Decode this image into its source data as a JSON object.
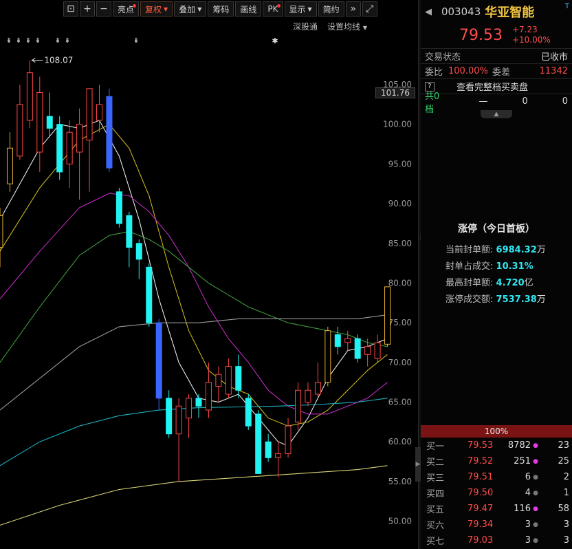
{
  "toolbar": {
    "buttons": [
      "亮点",
      "复权",
      "叠加",
      "筹码",
      "画线",
      "PK",
      "显示",
      "简约"
    ]
  },
  "subbar": {
    "shengu": "深股通",
    "ma_setting": "设置均线"
  },
  "chart": {
    "current_price_tag": "101.76",
    "high_label": "108.07",
    "y_ticks": [
      "105.00",
      "100.00",
      "95.00",
      "90.00",
      "85.00",
      "80.00",
      "75.00",
      "70.00",
      "65.00",
      "60.00",
      "55.00",
      "50.00"
    ]
  },
  "chart_data": {
    "type": "candlestick",
    "y_axis_range": [
      46.5,
      111.5
    ],
    "y_ticks": [
      105,
      100,
      95,
      90,
      85,
      80,
      75,
      70,
      65,
      60,
      55,
      50
    ],
    "annotated_high": 108.07,
    "candles": [
      {
        "o": 84.5,
        "c": 88.5,
        "h": 89.5,
        "l": 82.0,
        "up": true
      },
      {
        "o": 92.5,
        "c": 97.0,
        "h": 99.0,
        "l": 91.5,
        "up": true
      },
      {
        "o": 96.0,
        "c": 102.5,
        "h": 105.0,
        "l": 95.5,
        "up": true
      },
      {
        "o": 100.5,
        "c": 106.5,
        "h": 108.07,
        "l": 99.5,
        "up": true
      },
      {
        "o": 96.5,
        "c": 104.0,
        "h": 106.0,
        "l": 94.0,
        "up": true
      },
      {
        "o": 101.0,
        "c": 99.5,
        "h": 104.0,
        "l": 98.5,
        "up": false
      },
      {
        "o": 100.0,
        "c": 94.0,
        "h": 101.0,
        "l": 93.0,
        "up": false
      },
      {
        "o": 95.0,
        "c": 99.0,
        "h": 100.5,
        "l": 92.0,
        "up": true
      },
      {
        "o": 96.5,
        "c": 100.0,
        "h": 102.0,
        "l": 90.5,
        "up": true
      },
      {
        "o": 98.0,
        "c": 104.5,
        "h": 104.5,
        "l": 91.5,
        "up": true
      },
      {
        "o": 100.5,
        "c": 102.5,
        "h": 105.0,
        "l": 99.0,
        "up": true
      },
      {
        "o": 103.5,
        "c": 94.5,
        "h": 104.5,
        "l": 94.0,
        "up": false
      },
      {
        "o": 91.5,
        "c": 87.5,
        "h": 92.0,
        "l": 87.0,
        "up": false
      },
      {
        "o": 88.5,
        "c": 84.5,
        "h": 89.0,
        "l": 82.0,
        "up": false
      },
      {
        "o": 85.0,
        "c": 83.0,
        "h": 85.5,
        "l": 80.5,
        "up": false
      },
      {
        "o": 82.0,
        "c": 75.0,
        "h": 82.5,
        "l": 74.5,
        "up": false
      },
      {
        "o": 75.0,
        "c": 65.5,
        "h": 75.5,
        "l": 64.0,
        "up": false
      },
      {
        "o": 65.5,
        "c": 61.0,
        "h": 66.5,
        "l": 60.5,
        "up": false
      },
      {
        "o": 61.0,
        "c": 64.5,
        "h": 65.5,
        "l": 55.0,
        "up": true
      },
      {
        "o": 63.0,
        "c": 65.5,
        "h": 66.0,
        "l": 60.5,
        "up": true
      },
      {
        "o": 65.5,
        "c": 64.5,
        "h": 66.0,
        "l": 63.0,
        "up": false
      },
      {
        "o": 64.0,
        "c": 67.5,
        "h": 70.0,
        "l": 63.0,
        "up": true
      },
      {
        "o": 67.0,
        "c": 68.5,
        "h": 69.5,
        "l": 65.0,
        "up": true
      },
      {
        "o": 66.0,
        "c": 69.5,
        "h": 70.5,
        "l": 65.5,
        "up": true
      },
      {
        "o": 69.5,
        "c": 66.5,
        "h": 71.0,
        "l": 65.5,
        "up": false
      },
      {
        "o": 65.5,
        "c": 62.0,
        "h": 66.0,
        "l": 61.5,
        "up": false
      },
      {
        "o": 63.5,
        "c": 56.0,
        "h": 64.0,
        "l": 56.0,
        "up": false
      },
      {
        "o": 60.0,
        "c": 58.0,
        "h": 61.0,
        "l": 57.5,
        "up": false
      },
      {
        "o": 58.0,
        "c": 58.5,
        "h": 60.0,
        "l": 55.5,
        "up": true
      },
      {
        "o": 58.5,
        "c": 62.0,
        "h": 63.0,
        "l": 58.0,
        "up": true
      },
      {
        "o": 62.5,
        "c": 66.5,
        "h": 67.5,
        "l": 61.5,
        "up": true
      },
      {
        "o": 65.0,
        "c": 66.5,
        "h": 67.5,
        "l": 64.5,
        "up": true
      },
      {
        "o": 66.0,
        "c": 67.5,
        "h": 70.0,
        "l": 65.5,
        "up": true
      },
      {
        "o": 67.5,
        "c": 74.0,
        "h": 74.5,
        "l": 67.0,
        "up": true
      },
      {
        "o": 73.5,
        "c": 72.0,
        "h": 74.5,
        "l": 71.0,
        "up": false
      },
      {
        "o": 72.5,
        "c": 73.0,
        "h": 74.0,
        "l": 71.5,
        "up": true
      },
      {
        "o": 73.0,
        "c": 70.5,
        "h": 73.5,
        "l": 70.0,
        "up": false
      },
      {
        "o": 71.0,
        "c": 72.0,
        "h": 73.0,
        "l": 69.5,
        "up": true
      },
      {
        "o": 70.5,
        "c": 72.5,
        "h": 73.5,
        "l": 70.0,
        "up": true
      },
      {
        "o": 72.3,
        "c": 79.53,
        "h": 79.53,
        "l": 72.0,
        "up": true
      }
    ],
    "ma_series": [
      {
        "color": "#e8e8e8",
        "values": [
          [
            0,
            88
          ],
          [
            4,
            97
          ],
          [
            6,
            100
          ],
          [
            8,
            99.5
          ],
          [
            10,
            100.5
          ],
          [
            12,
            96
          ],
          [
            14,
            88
          ],
          [
            16,
            78
          ],
          [
            18,
            70
          ],
          [
            20,
            65.5
          ],
          [
            22,
            65
          ],
          [
            24,
            66
          ],
          [
            26,
            63
          ],
          [
            28,
            60
          ],
          [
            29,
            59.5
          ],
          [
            31,
            63
          ],
          [
            33,
            68
          ],
          [
            35,
            71.5
          ],
          [
            37,
            72
          ],
          [
            39,
            73
          ]
        ]
      },
      {
        "color": "#c9b41c",
        "values": [
          [
            0,
            84
          ],
          [
            4,
            92
          ],
          [
            8,
            98
          ],
          [
            11,
            100
          ],
          [
            13,
            97
          ],
          [
            15,
            91
          ],
          [
            17,
            82
          ],
          [
            19,
            74
          ],
          [
            21,
            69
          ],
          [
            23,
            67
          ],
          [
            25,
            66
          ],
          [
            27,
            63
          ],
          [
            29,
            62
          ],
          [
            31,
            62.5
          ],
          [
            33,
            64
          ],
          [
            35,
            66.5
          ],
          [
            37,
            69
          ],
          [
            39,
            71
          ]
        ]
      },
      {
        "color": "#c02ac0",
        "values": [
          [
            0,
            78
          ],
          [
            4,
            84
          ],
          [
            8,
            89.5
          ],
          [
            11,
            91.3
          ],
          [
            13,
            91
          ],
          [
            15,
            89
          ],
          [
            17,
            86
          ],
          [
            19,
            82
          ],
          [
            21,
            77
          ],
          [
            23,
            73
          ],
          [
            25,
            70
          ],
          [
            27,
            66.5
          ],
          [
            29,
            64.5
          ],
          [
            31,
            63.5
          ],
          [
            33,
            63.5
          ],
          [
            35,
            64.5
          ],
          [
            37,
            65.5
          ],
          [
            39,
            67.5
          ]
        ]
      },
      {
        "color": "#3f9a3f",
        "values": [
          [
            0,
            70
          ],
          [
            4,
            77
          ],
          [
            8,
            83.5
          ],
          [
            11,
            86
          ],
          [
            13,
            86.5
          ],
          [
            15,
            85.5
          ],
          [
            17,
            84
          ],
          [
            19,
            82
          ],
          [
            21,
            80
          ],
          [
            23,
            78.5
          ],
          [
            25,
            77
          ],
          [
            27,
            76
          ],
          [
            29,
            75
          ],
          [
            31,
            74.5
          ],
          [
            33,
            74
          ],
          [
            35,
            73.5
          ],
          [
            37,
            72.5
          ],
          [
            39,
            72
          ]
        ]
      },
      {
        "color": "#9a9a9a",
        "values": [
          [
            0,
            64
          ],
          [
            4,
            68
          ],
          [
            8,
            72
          ],
          [
            12,
            74.5
          ],
          [
            16,
            75
          ],
          [
            20,
            75
          ],
          [
            24,
            75.5
          ],
          [
            28,
            75.5
          ],
          [
            32,
            75.5
          ],
          [
            36,
            75.5
          ],
          [
            39,
            76
          ]
        ]
      },
      {
        "color": "#1eb0c0",
        "values": [
          [
            0,
            57
          ],
          [
            4,
            60
          ],
          [
            8,
            62
          ],
          [
            12,
            63.3
          ],
          [
            16,
            64
          ],
          [
            20,
            64.3
          ],
          [
            24,
            64.4
          ],
          [
            28,
            64.5
          ],
          [
            32,
            64.7
          ],
          [
            36,
            65
          ],
          [
            39,
            65.5
          ]
        ]
      },
      {
        "color": "#d8d478",
        "values": [
          [
            0,
            49.5
          ],
          [
            6,
            52
          ],
          [
            12,
            54
          ],
          [
            18,
            55
          ],
          [
            24,
            55.5
          ],
          [
            30,
            56
          ],
          [
            36,
            56.5
          ],
          [
            39,
            57
          ]
        ]
      }
    ]
  },
  "header": {
    "back": "◀",
    "code": "003043",
    "name": "华亚智能",
    "tag": "T",
    "price": "79.53",
    "change": "+7.23",
    "change_pct": "+10.00%"
  },
  "status": {
    "label": "交易状态",
    "value": "已收市"
  },
  "bid_ratio": {
    "label": "委比",
    "value": "100.00%",
    "label2": "委差",
    "value2": "11342"
  },
  "full_book": {
    "q": "?",
    "label": "查看完整档买卖盘"
  },
  "total": {
    "label": "共0档",
    "dash": "—",
    "v1": "0",
    "v2": "0"
  },
  "limit": {
    "title": "涨停（今日首板）",
    "rows": [
      {
        "label": "当前封单额:",
        "value": "6984.32",
        "unit": "万"
      },
      {
        "label": "封单占成交:",
        "value": "10.31%",
        "unit": ""
      },
      {
        "label": "最高封单额:",
        "value": "4.720",
        "unit": "亿"
      },
      {
        "label": "涨停成交额:",
        "value": "7537.38",
        "unit": "万"
      }
    ]
  },
  "pct_bar": "100%",
  "bids": [
    {
      "label": "买一",
      "price": "79.53",
      "vol": "8782",
      "dot": "#e33ae3",
      "cnt": "23"
    },
    {
      "label": "买二",
      "price": "79.52",
      "vol": "251",
      "dot": "#e33ae3",
      "cnt": "25"
    },
    {
      "label": "买三",
      "price": "79.51",
      "vol": "6",
      "dot": "#777777",
      "cnt": "2"
    },
    {
      "label": "买四",
      "price": "79.50",
      "vol": "4",
      "dot": "#777777",
      "cnt": "1"
    },
    {
      "label": "买五",
      "price": "79.47",
      "vol": "116",
      "dot": "#e33ae3",
      "cnt": "58"
    },
    {
      "label": "买六",
      "price": "79.34",
      "vol": "3",
      "dot": "#777777",
      "cnt": "3"
    },
    {
      "label": "买七",
      "price": "79.03",
      "vol": "3",
      "dot": "#777777",
      "cnt": "3"
    }
  ]
}
